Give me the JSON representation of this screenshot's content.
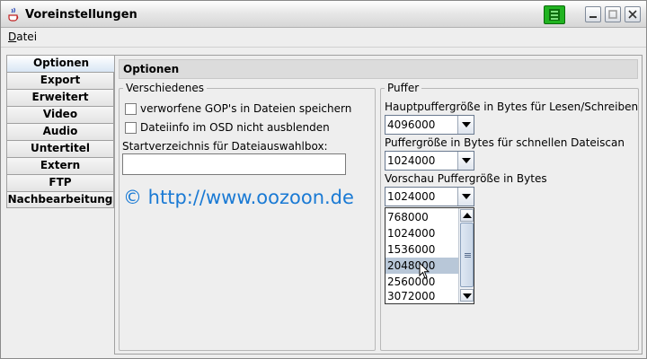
{
  "window": {
    "title": "Voreinstellungen"
  },
  "menubar": {
    "items": [
      {
        "mnemonic": "D",
        "rest": "atei"
      }
    ]
  },
  "tabs": [
    {
      "label": "Optionen",
      "active": true
    },
    {
      "label": "Export"
    },
    {
      "label": "Erweitert"
    },
    {
      "label": "Video"
    },
    {
      "label": "Audio"
    },
    {
      "label": "Untertitel"
    },
    {
      "label": "Extern"
    },
    {
      "label": "FTP"
    },
    {
      "label": "Nachbearbeitung"
    }
  ],
  "content": {
    "header": "Optionen",
    "verschiedenes": {
      "title": "Verschiedenes",
      "checkbox1": "verworfene GOP's in Dateien speichern",
      "checkbox2": "Dateiinfo im OSD nicht ausblenden",
      "startdir_label": "Startverzeichnis für Dateiauswahlbox:",
      "startdir_value": "",
      "watermark": "© http://www.oozoon.de"
    },
    "puffer": {
      "title": "Puffer",
      "main_label": "Hauptpuffergröße in Bytes für Lesen/Schreiben",
      "main_value": "4096000",
      "scan_label": "Puffergröße in Bytes für schnellen Dateiscan",
      "scan_value": "1024000",
      "preview_label": "Vorschau Puffergröße in Bytes",
      "preview_value": "1024000",
      "dropdown_options": [
        "768000",
        "1024000",
        "1536000",
        "2048000",
        "2560000",
        "3072000"
      ],
      "dropdown_highlighted": "2048000"
    }
  },
  "colors": {
    "watermark": "#1a7ad4",
    "highlight": "#b8c7d8",
    "tray_green": "#21b321"
  }
}
